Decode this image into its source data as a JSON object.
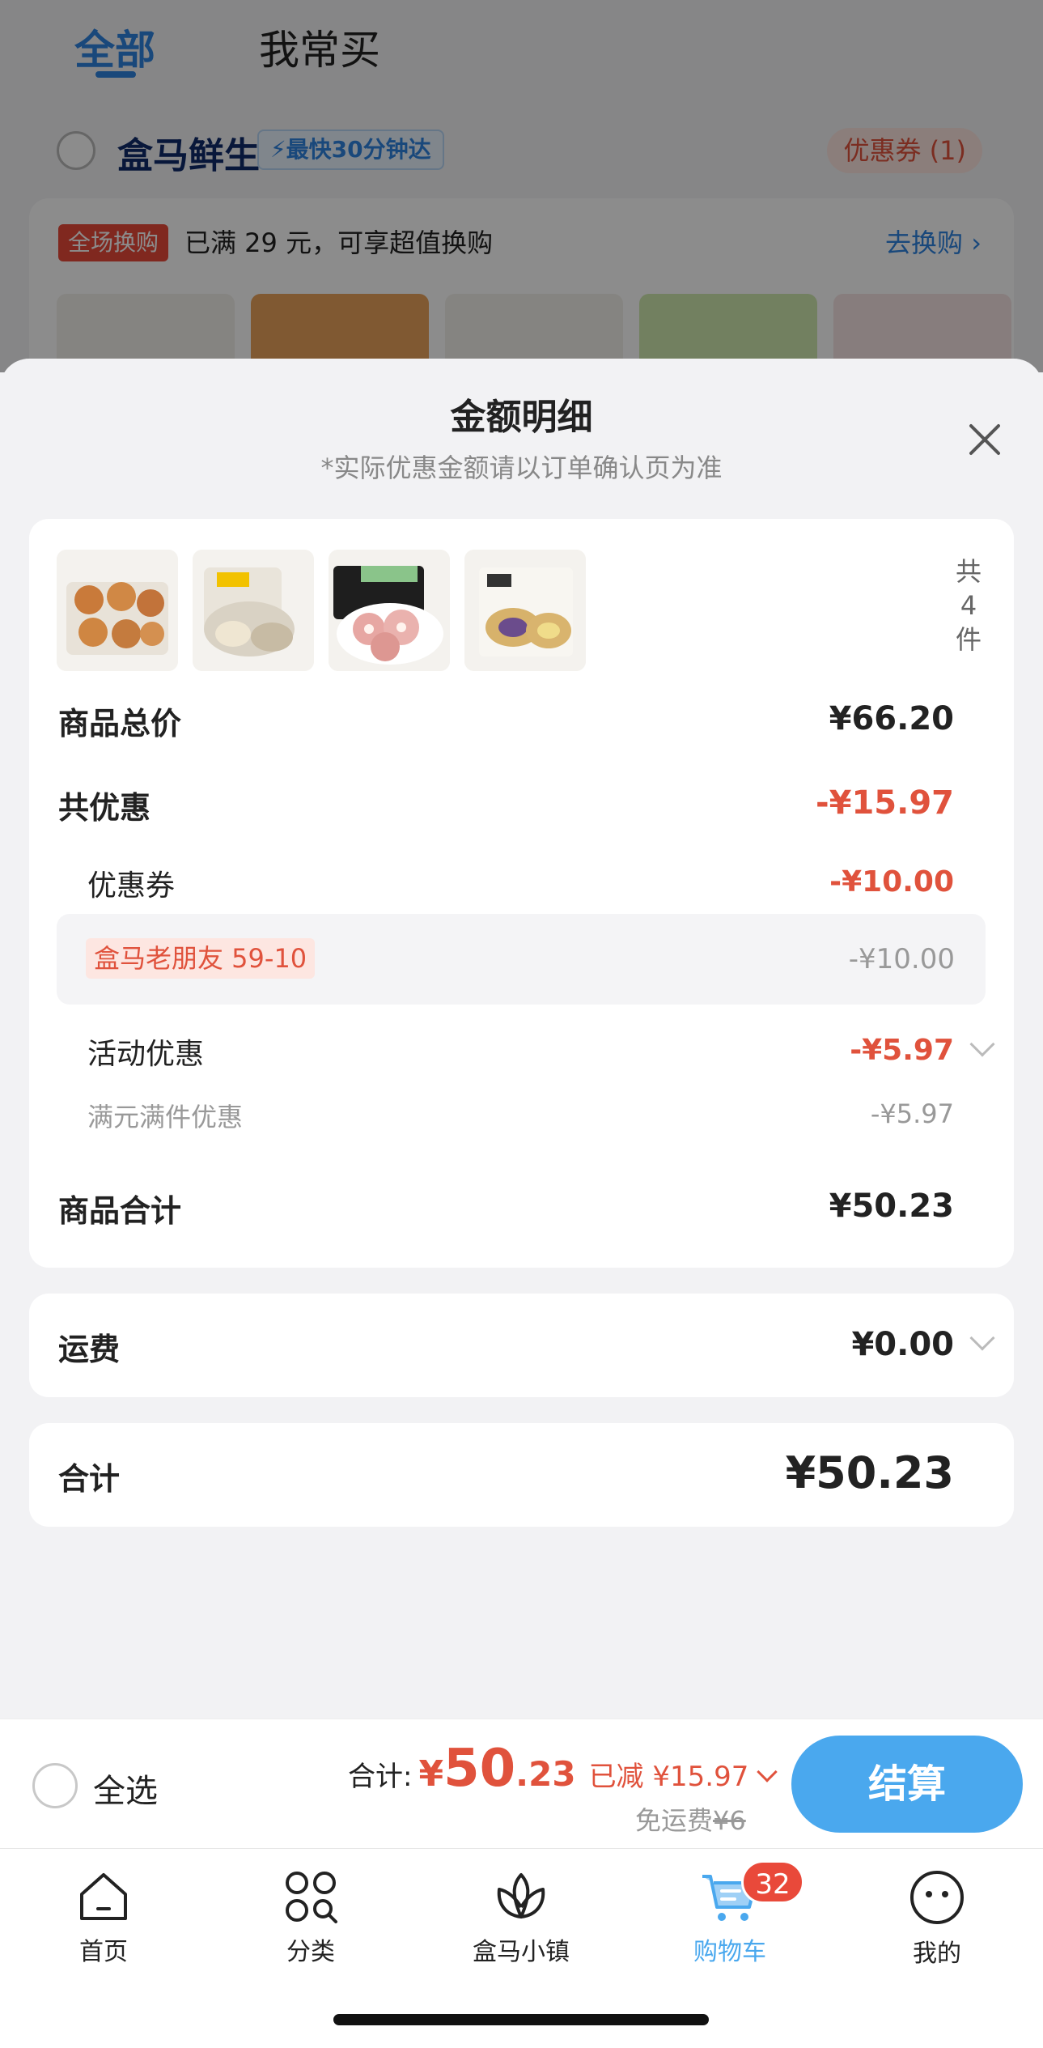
{
  "tabs": {
    "all": "全部",
    "frequent": "我常买"
  },
  "store": {
    "name": "盒马鲜生",
    "badge": "最快30分钟达",
    "coupon": "优惠券 (1)"
  },
  "promo": {
    "tag": "全场换购",
    "text": "已满 29 元，可享超值换购",
    "link": "去换购"
  },
  "sheet": {
    "title": "金额明细",
    "subtitle": "*实际优惠金额请以订单确认页为准",
    "item_count_chars": [
      "共",
      "4",
      "件"
    ],
    "products": [
      "cookie-tray",
      "bun-pack",
      "pork-tray",
      "flatbread-pack"
    ],
    "rows": {
      "subtotal_label": "商品总价",
      "subtotal_value": "¥66.20",
      "discount_label": "共优惠",
      "discount_value": "-¥15.97",
      "coupon_label": "优惠券",
      "coupon_value": "-¥10.00",
      "coupon_name": "盒马老朋友 59-10",
      "coupon_name_value": "-¥10.00",
      "activity_label": "活动优惠",
      "activity_value": "-¥5.97",
      "activity_sub_label": "满元满件优惠",
      "activity_sub_value": "-¥5.97",
      "goods_total_label": "商品合计",
      "goods_total_value": "¥50.23"
    },
    "shipping_label": "运费",
    "shipping_value": "¥0.00",
    "total_label": "合计",
    "total_value": "¥50.23"
  },
  "checkout": {
    "select_all": "全选",
    "sum_label": "合计:",
    "yen": "¥",
    "sum_int": "50",
    "sum_dec": ".23",
    "reduced": "已减 ¥15.97",
    "freeship_label": "免运费",
    "freeship_original": "¥6",
    "pay": "结算"
  },
  "tabbar": {
    "items": [
      {
        "label": "首页",
        "icon": "home-icon"
      },
      {
        "label": "分类",
        "icon": "category-icon"
      },
      {
        "label": "盒马小镇",
        "icon": "town-icon"
      },
      {
        "label": "购物车",
        "icon": "cart-icon",
        "badge": "32"
      },
      {
        "label": "我的",
        "icon": "profile-icon"
      }
    ]
  },
  "colors": {
    "accent": "#4aa8ee",
    "price_red": "#e0523c",
    "brand_blue": "#2f83e0"
  }
}
